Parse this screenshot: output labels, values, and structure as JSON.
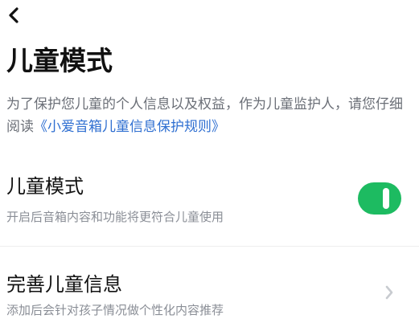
{
  "header": {
    "back_icon": "chevron-left-icon",
    "title": "儿童模式"
  },
  "intro": {
    "text": "为了保护您儿童的个人信息以及权益，作为儿童监护人，请您仔细阅读",
    "link_text": "《小爱音箱儿童信息保护规则》"
  },
  "child_mode": {
    "title": "儿童模式",
    "subtitle": "开启后音箱内容和功能将更符合儿童使用",
    "toggle_on": true,
    "toggle_color": "#1dbb61"
  },
  "child_info": {
    "title": "完善儿童信息",
    "subtitle": "添加后会针对孩子情况做个性化内容推荐",
    "chevron_icon": "chevron-right-icon"
  },
  "colors": {
    "link": "#2f6fd1",
    "secondary_text": "#8a8e96"
  }
}
